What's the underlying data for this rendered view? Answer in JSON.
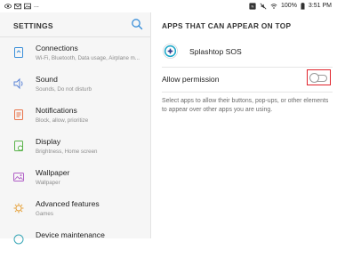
{
  "status_bar": {
    "left_icons": [
      "eye-icon",
      "mail-icon",
      "gallery-icon",
      "more-dots"
    ],
    "more_text": "...",
    "right_icons": [
      "nfc-icon",
      "mute-icon",
      "wifi-icon"
    ],
    "battery_percent": "100%",
    "battery_icon": "battery-full-icon",
    "time": "3:51 PM"
  },
  "left_pane": {
    "title": "SETTINGS",
    "search_icon": "search-icon",
    "items": [
      {
        "title": "Connections",
        "subtitle": "Wi-Fi, Bluetooth, Data usage, Airplane m...",
        "icon": "connections-icon",
        "color": "#3a8fd9"
      },
      {
        "title": "Sound",
        "subtitle": "Sounds, Do not disturb",
        "icon": "sound-icon",
        "color": "#5b84d6"
      },
      {
        "title": "Notifications",
        "subtitle": "Block, allow, prioritize",
        "icon": "notifications-icon",
        "color": "#e8744a"
      },
      {
        "title": "Display",
        "subtitle": "Brightness, Home screen",
        "icon": "display-icon",
        "color": "#5ab34a"
      },
      {
        "title": "Wallpaper",
        "subtitle": "Wallpaper",
        "icon": "wallpaper-icon",
        "color": "#b15fc7"
      },
      {
        "title": "Advanced features",
        "subtitle": "Games",
        "icon": "advanced-features-icon",
        "color": "#e6a23c"
      },
      {
        "title": "Device maintenance",
        "subtitle": "",
        "icon": "device-maintenance-icon",
        "color": "#3aa7b7"
      }
    ]
  },
  "right_pane": {
    "title": "APPS THAT CAN APPEAR ON TOP",
    "app_name": "Splashtop SOS",
    "app_icon": "splashtop-sos-icon",
    "permission_label": "Allow permission",
    "permission_enabled": false,
    "highlight_color": "#e0232b",
    "description": "Select apps to allow their buttons, pop-ups, or other elements to appear over other apps you are using."
  }
}
